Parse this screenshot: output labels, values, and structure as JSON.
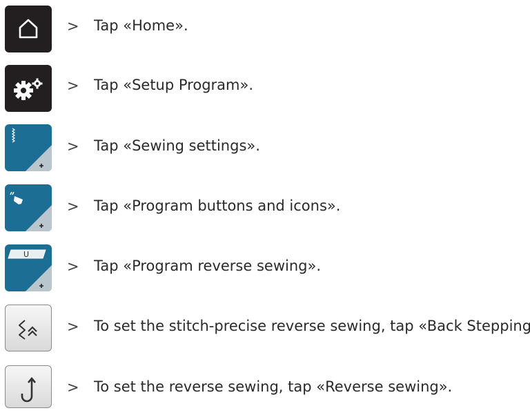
{
  "steps": [
    {
      "icon": "home-icon",
      "arrow": ">",
      "text": "Tap «Home»."
    },
    {
      "icon": "setup-program-gears-icon",
      "arrow": ">",
      "text": "Tap «Setup Program»."
    },
    {
      "icon": "sewing-settings-icon",
      "arrow": ">",
      "text": "Tap «Sewing settings»."
    },
    {
      "icon": "program-buttons-icons-icon",
      "arrow": ">",
      "text": "Tap «Program buttons and icons»."
    },
    {
      "icon": "program-reverse-sewing-icon",
      "arrow": ">",
      "text": "Tap «Program reverse sewing»."
    },
    {
      "icon": "back-stepping-icon",
      "arrow": ">",
      "text": "To set the stitch-precise reverse sewing, tap «Back Stepping»."
    },
    {
      "icon": "reverse-sewing-icon",
      "arrow": ">",
      "text": "To set the reverse sewing, tap «Reverse sewing»."
    }
  ],
  "button_labels": {
    "reverse_tab": "U"
  },
  "colors": {
    "dark_button": "#231f20",
    "blue_button": "#1d6e95",
    "gray_button": "#e6e6e6"
  }
}
